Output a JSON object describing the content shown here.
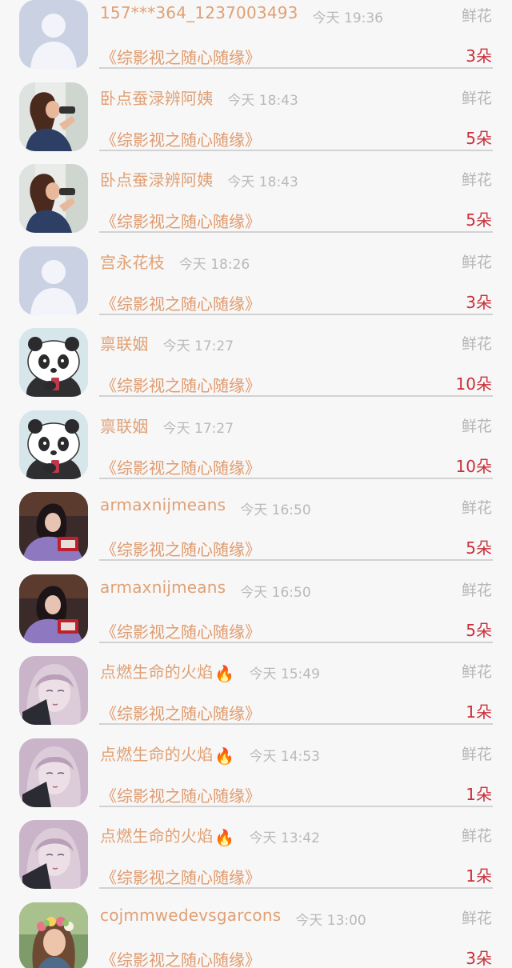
{
  "gift_list": {
    "items": [
      {
        "name": "157***364_1237003493",
        "time": "今天 19:36",
        "gift_type": "鲜花",
        "book_title": "《综影视之随心随缘》",
        "count": "3朵",
        "avatar": "default-avatar-icon"
      },
      {
        "name": "卧点蚕渌辨阿姨",
        "time": "今天 18:43",
        "gift_type": "鲜花",
        "book_title": "《综影视之随心随缘》",
        "count": "5朵",
        "avatar": "photo-avatar-woman-binoculars"
      },
      {
        "name": "卧点蚕渌辨阿姨",
        "time": "今天 18:43",
        "gift_type": "鲜花",
        "book_title": "《综影视之随心随缘》",
        "count": "5朵",
        "avatar": "photo-avatar-woman-binoculars"
      },
      {
        "name": "宫永花枝",
        "time": "今天 18:26",
        "gift_type": "鲜花",
        "book_title": "《综影视之随心随缘》",
        "count": "3朵",
        "avatar": "default-avatar-icon"
      },
      {
        "name": "禀联姻",
        "time": "今天 17:27",
        "gift_type": "鲜花",
        "book_title": "《综影视之随心随缘》",
        "count": "10朵",
        "avatar": "panda-avatar"
      },
      {
        "name": "禀联姻",
        "time": "今天 17:27",
        "gift_type": "鲜花",
        "book_title": "《综影视之随心随缘》",
        "count": "10朵",
        "avatar": "panda-avatar"
      },
      {
        "name": "armaxnijmeans",
        "time": "今天 16:50",
        "gift_type": "鲜花",
        "book_title": "《综影视之随心随缘》",
        "count": "5朵",
        "avatar": "photo-avatar-girl-purple"
      },
      {
        "name": "armaxnijmeans",
        "time": "今天 16:50",
        "gift_type": "鲜花",
        "book_title": "《综影视之随心随缘》",
        "count": "5朵",
        "avatar": "photo-avatar-girl-purple"
      },
      {
        "name": "点燃生命的火焰",
        "fire_emoji": "🔥",
        "time": "今天 15:49",
        "gift_type": "鲜花",
        "book_title": "《综影视之随心随缘》",
        "count": "1朵",
        "avatar": "anime-avatar-sketch"
      },
      {
        "name": "点燃生命的火焰",
        "fire_emoji": "🔥",
        "time": "今天 14:53",
        "gift_type": "鲜花",
        "book_title": "《综影视之随心随缘》",
        "count": "1朵",
        "avatar": "anime-avatar-sketch"
      },
      {
        "name": "点燃生命的火焰",
        "fire_emoji": "🔥",
        "time": "今天 13:42",
        "gift_type": "鲜花",
        "book_title": "《综影视之随心随缘》",
        "count": "1朵",
        "avatar": "anime-avatar-sketch"
      },
      {
        "name": "cojmmwedevsgarcons",
        "time": "今天 13:00",
        "gift_type": "鲜花",
        "book_title": "《综影视之随心随缘》",
        "count": "3朵",
        "avatar": "photo-avatar-flower-crown"
      }
    ]
  },
  "colors": {
    "background": "#f7f7f7",
    "name": "#e0a074",
    "time": "#b9b9b9",
    "gift_type": "#b5b5b5",
    "book_title": "#e09a6c",
    "count": "#c9303a",
    "divider": "#d2d2d2"
  }
}
